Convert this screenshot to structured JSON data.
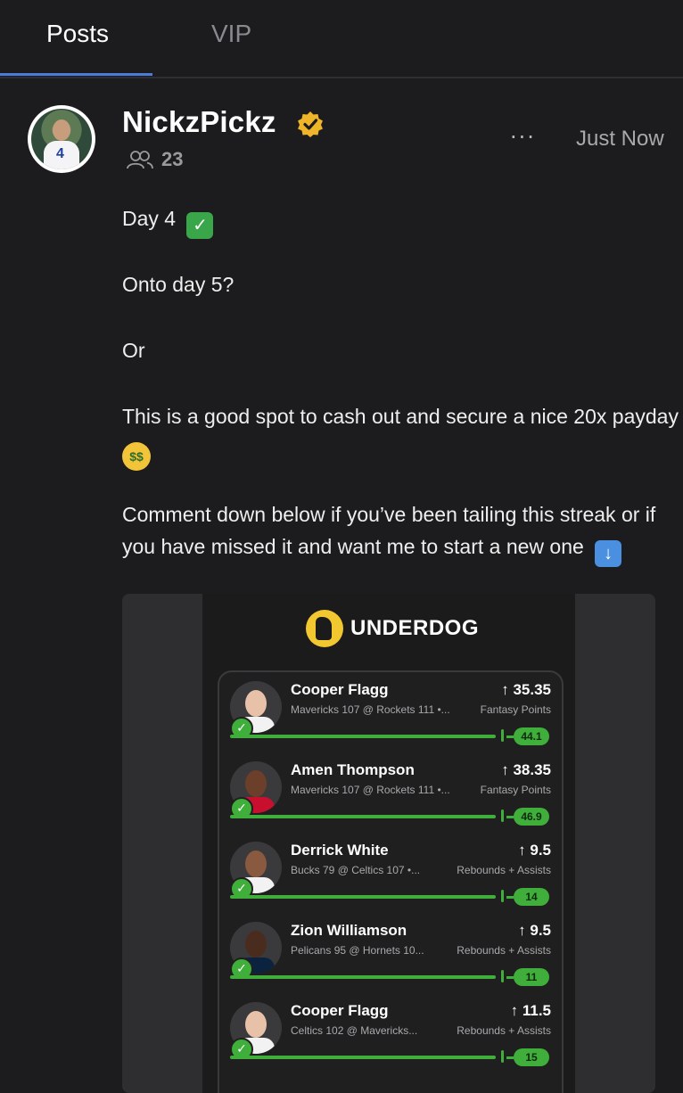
{
  "tabs": [
    {
      "label": "Posts",
      "active": true
    },
    {
      "label": "VIP",
      "active": false
    }
  ],
  "post": {
    "author": "NickzPickz",
    "verified": true,
    "members_count": "23",
    "time": "Just Now",
    "more_label": "···",
    "avatar_number": "4",
    "lines": {
      "l1": "Day 4",
      "l2": "Onto day 5?",
      "l3": "Or",
      "l4": "This is a good spot to cash out and secure a nice 20x payday",
      "l5": "Comment down below if you’ve been tailing this streak or if",
      "l6": "you have missed it and want me to start a new one"
    },
    "emojis": {
      "check": "✓",
      "money": "$$",
      "down": "↓"
    }
  },
  "card": {
    "brand": "UNDERDOG",
    "picks": [
      {
        "name": "Cooper Flagg",
        "game": "Mavericks 107 @ Rockets 111 •...",
        "line": "↑ 35.35",
        "stat": "Fantasy Points",
        "result": "44.1"
      },
      {
        "name": "Amen Thompson",
        "game": "Mavericks 107 @ Rockets 111 •...",
        "line": "↑ 38.35",
        "stat": "Fantasy Points",
        "result": "46.9"
      },
      {
        "name": "Derrick White",
        "game": "Bucks 79 @ Celtics 107 •...",
        "line": "↑ 9.5",
        "stat": "Rebounds + Assists",
        "result": "14"
      },
      {
        "name": "Zion Williamson",
        "game": "Pelicans 95 @ Hornets 10...",
        "line": "↑ 9.5",
        "stat": "Rebounds + Assists",
        "result": "11"
      },
      {
        "name": "Cooper Flagg",
        "game": "Celtics 102 @ Mavericks...",
        "line": "↑ 11.5",
        "stat": "Rebounds + Assists",
        "result": "15"
      }
    ]
  },
  "colors": {
    "accent_tab": "#4c7bd9",
    "verified_badge": "#f0b429",
    "hit_green": "#3fae3a",
    "brand_yellow": "#f2c830"
  }
}
